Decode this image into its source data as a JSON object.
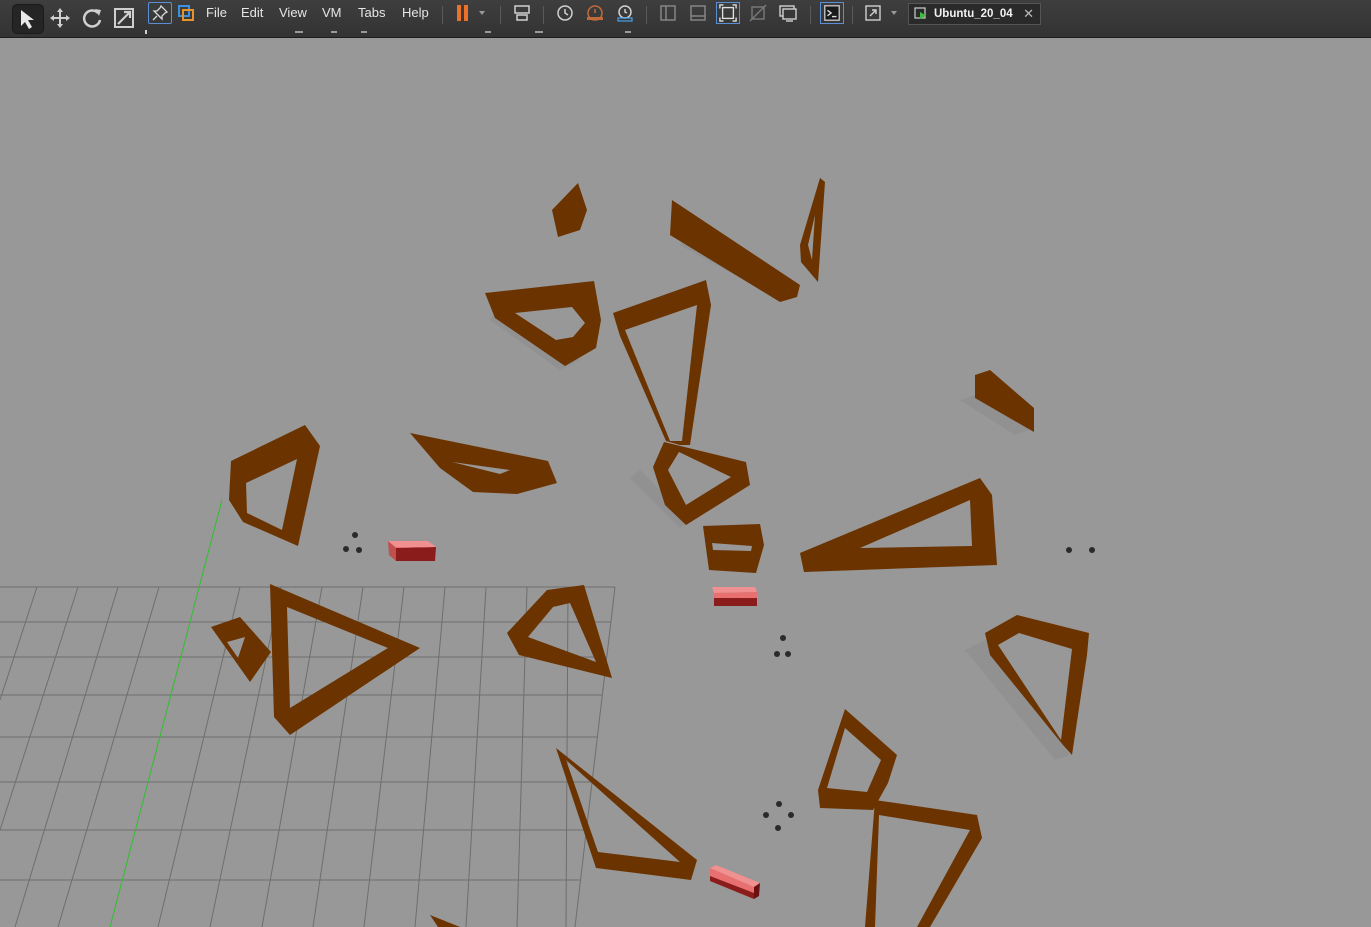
{
  "menu": {
    "file": "File",
    "edit": "Edit",
    "view": "View",
    "vm": "VM",
    "tabs": "Tabs",
    "help": "Help"
  },
  "tab": {
    "label": "Ubuntu_20_04",
    "close": "✕"
  },
  "colors": {
    "toolbar_bg": "#383838",
    "viewport_bg": "#989898",
    "obstacle_wall": "#6b3300",
    "wall_shadow": "#8e8e8e",
    "robot_box": "#e87070",
    "robot_box_side": "#8b1c1c",
    "grid_line": "#6e6e6e",
    "axis_green": "#2fbf2f",
    "pause_orange": "#e8722a"
  },
  "icons": [
    "select-arrow-icon",
    "translate-icon",
    "rotate-icon",
    "scale-icon",
    "pin-icon",
    "vm-library-icon",
    "pause-icon",
    "send-ctrl-alt-del-icon",
    "snapshot-icon",
    "revert-snapshot-icon",
    "snapshot-manager-icon",
    "show-sidebar-icon",
    "show-thumbnail-icon",
    "fit-guest-icon",
    "unity-icon",
    "console-view-icon",
    "terminal-icon",
    "fullscreen-icon",
    "vm-running-icon"
  ]
}
